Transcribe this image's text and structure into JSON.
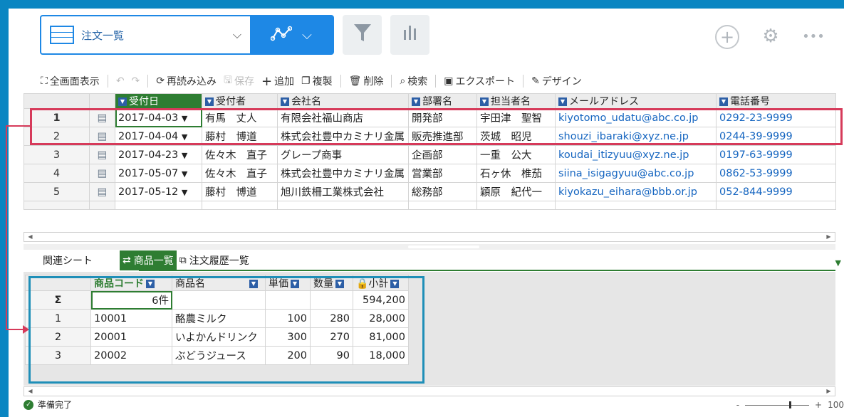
{
  "view": {
    "name": "注文一覧"
  },
  "toolbar": {
    "fullscreen": "全画面表示",
    "reload": "再読み込み",
    "save": "保存",
    "add": "追加",
    "duplicate": "複製",
    "delete": "削除",
    "search": "検索",
    "export": "エクスポート",
    "design": "デザイン"
  },
  "main_grid": {
    "columns": [
      "受付日",
      "受付者",
      "会社名",
      "部署名",
      "担当者名",
      "メールアドレス",
      "電話番号"
    ],
    "rows": [
      {
        "n": "1",
        "date": "2017-04-03",
        "staff": "有馬　丈人",
        "company": "有限会社福山商店",
        "dept": "開発部",
        "person": "宇田津　聖智",
        "email": "kiyotomo_udatu@abc.co.jp",
        "phone": "0292-23-9999"
      },
      {
        "n": "2",
        "date": "2017-04-04",
        "staff": "藤村　博道",
        "company": "株式会社豊中カミナリ金属",
        "dept": "販売推進部",
        "person": "茨城　昭児",
        "email": "shouzi_ibaraki@xyz.ne.jp",
        "phone": "0244-39-9999"
      },
      {
        "n": "3",
        "date": "2017-04-23",
        "staff": "佐々木　直子",
        "company": "グレープ商事",
        "dept": "企画部",
        "person": "一重　公大",
        "email": "koudai_itizyuu@xyz.ne.jp",
        "phone": "0197-63-9999"
      },
      {
        "n": "4",
        "date": "2017-05-07",
        "staff": "佐々木　直子",
        "company": "株式会社豊中カミナリ金属",
        "dept": "営業部",
        "person": "石ヶ休　椎茄",
        "email": "siina_isigagyuu@abc.co.jp",
        "phone": "0862-53-9999"
      },
      {
        "n": "5",
        "date": "2017-05-12",
        "staff": "藤村　博道",
        "company": "旭川鉄柵工業株式会社",
        "dept": "総務部",
        "person": "穎原　紀代一",
        "email": "kiyokazu_eihara@bbb.or.jp",
        "phone": "052-844-9999"
      }
    ]
  },
  "tabs": {
    "label": "関連シート",
    "items": [
      "商品一覧",
      "注文履歴一覧"
    ]
  },
  "sub_grid": {
    "columns": [
      "商品コード",
      "商品名",
      "単価",
      "数量",
      "小計"
    ],
    "summary": {
      "count": "6件",
      "total": "594,200",
      "sigma": "Σ"
    },
    "rows": [
      {
        "n": "1",
        "code": "10001",
        "name": "酪農ミルク",
        "price": "100",
        "qty": "280",
        "subtotal": "28,000"
      },
      {
        "n": "2",
        "code": "20001",
        "name": "いよかんドリンク",
        "price": "300",
        "qty": "270",
        "subtotal": "81,000"
      },
      {
        "n": "3",
        "code": "20002",
        "name": "ぶどうジュース",
        "price": "200",
        "qty": "90",
        "subtotal": "18,000"
      }
    ]
  },
  "status": {
    "text": "準備完了",
    "zoom": "100"
  },
  "colors": {
    "accent": "#1e88e5",
    "frame": "#0a86c2",
    "green": "#2e7d32",
    "highlight_red": "#d63a5a",
    "highlight_blue": "#1f8fb8"
  }
}
